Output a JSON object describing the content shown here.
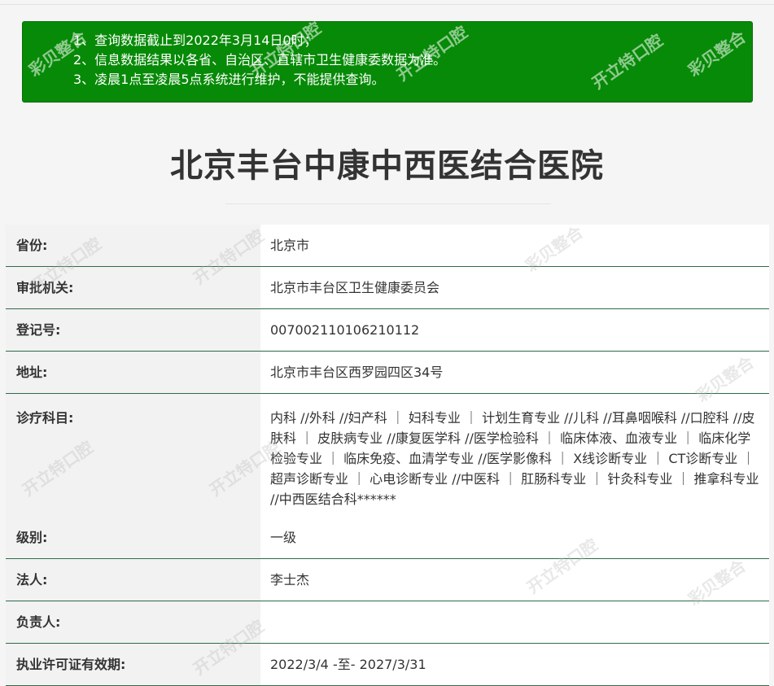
{
  "notice": {
    "lines": [
      "1、查询数据截止到2022年3月14日0时；",
      "2、信息数据结果以各省、自治区、直辖市卫生健康委数据为准。",
      "3、凌晨1点至凌晨5点系统进行维护，不能提供查询。"
    ],
    "background_color": "#078a07"
  },
  "hospital_name": "北京丰台中康中西医结合医院",
  "rows": [
    {
      "label": "省份:",
      "value": "北京市"
    },
    {
      "label": "审批机关:",
      "value": "北京市丰台区卫生健康委员会"
    },
    {
      "label": "登记号:",
      "value": "007002110106210112"
    },
    {
      "label": "地址:",
      "value": "北京市丰台区西罗园四区34号"
    },
    {
      "label": "诊疗科目:",
      "value": "内科 //外科 //妇产科 ｜ 妇科专业 ｜ 计划生育专业 //儿科 //耳鼻咽喉科 //口腔科 //皮肤科 ｜ 皮肤病专业 //康复医学科 //医学检验科 ｜ 临床体液、血液专业 ｜ 临床化学检验专业 ｜ 临床免疫、血清学专业 //医学影像科 ｜ X线诊断专业 ｜ CT诊断专业 ｜ 超声诊断专业 ｜ 心电诊断专业 //中医科 ｜ 肛肠科专业 ｜ 针灸科专业 ｜ 推拿科专业 //中西医结合科******"
    },
    {
      "label": "级别:",
      "value": "一级"
    },
    {
      "label": "法人:",
      "value": "李士杰"
    },
    {
      "label": "负责人:",
      "value": ""
    },
    {
      "label": "执业许可证有效期:",
      "value": "2022/3/4 -至- 2027/3/31"
    }
  ],
  "watermark": {
    "text_a": "彩贝整合",
    "text_b": "开立特口腔"
  }
}
